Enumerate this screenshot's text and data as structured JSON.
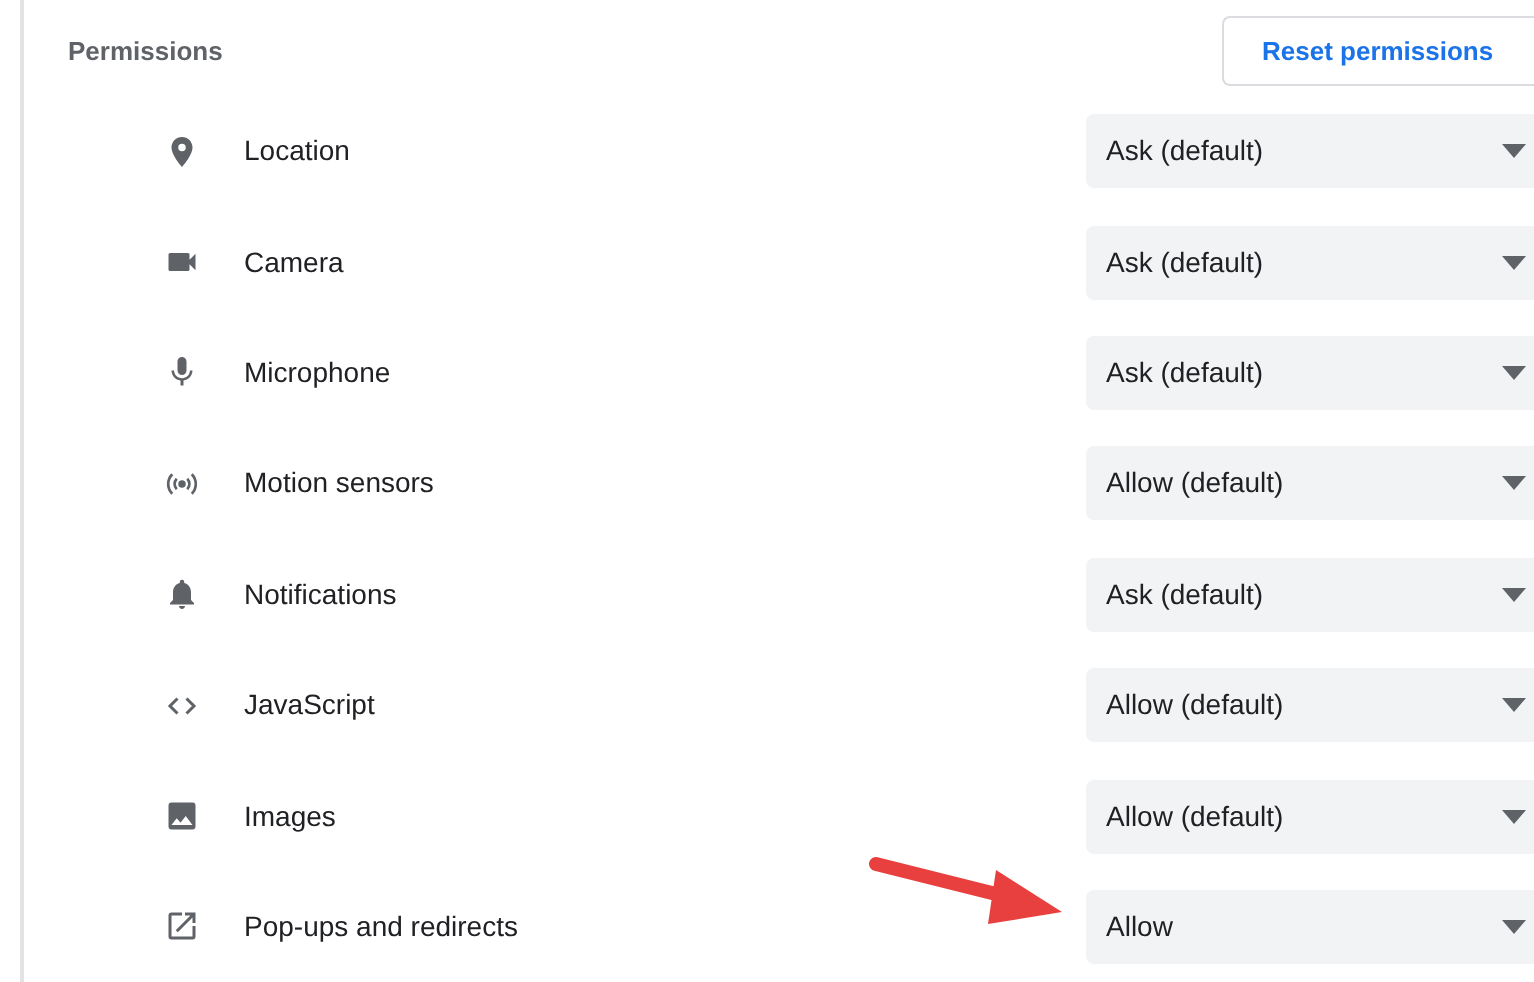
{
  "section_title": "Permissions",
  "reset_button": "Reset permissions",
  "permissions": [
    {
      "kind": "location",
      "label": "Location",
      "value": "Ask (default)"
    },
    {
      "kind": "camera",
      "label": "Camera",
      "value": "Ask (default)"
    },
    {
      "kind": "microphone",
      "label": "Microphone",
      "value": "Ask (default)"
    },
    {
      "kind": "motion",
      "label": "Motion sensors",
      "value": "Allow (default)"
    },
    {
      "kind": "notifications",
      "label": "Notifications",
      "value": "Ask (default)"
    },
    {
      "kind": "javascript",
      "label": "JavaScript",
      "value": "Allow (default)"
    },
    {
      "kind": "images",
      "label": "Images",
      "value": "Allow (default)"
    },
    {
      "kind": "popups",
      "label": "Pop-ups and redirects",
      "value": "Allow"
    }
  ]
}
